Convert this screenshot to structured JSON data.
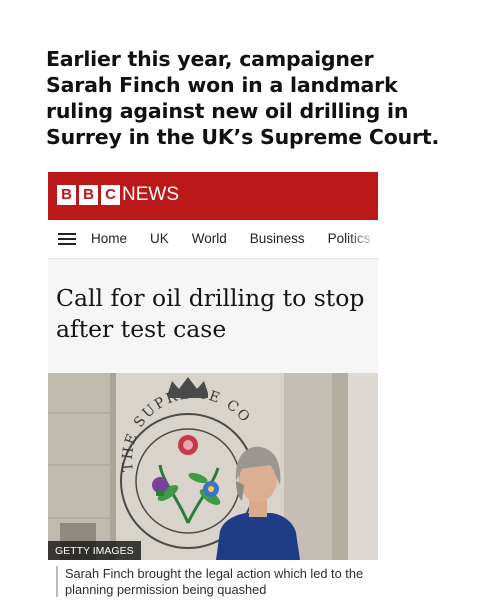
{
  "intro": {
    "text": "Earlier this year, campaigner Sarah Finch won in a landmark ruling against new oil drilling in Surrey in the UK’s Supreme Court."
  },
  "header": {
    "logo_letters": [
      "B",
      "B",
      "C"
    ],
    "news_label": "NEWS",
    "brand_color": "#bb1919"
  },
  "nav": {
    "menu_icon": "hamburger-icon",
    "items": [
      "Home",
      "UK",
      "World",
      "Business",
      "Politics"
    ]
  },
  "article": {
    "headline": "Call for oil drilling to stop after test case",
    "image": {
      "credit": "GETTY IMAGES",
      "emblem_text": "THE SUPREME CO"
    },
    "caption": "Sarah Finch brought the legal action which led to the planning permission being quashed"
  }
}
